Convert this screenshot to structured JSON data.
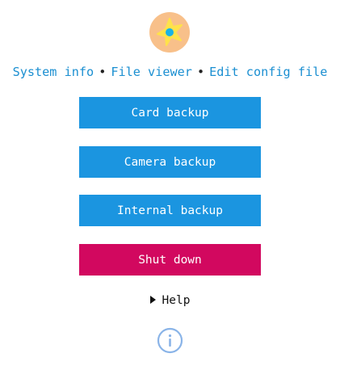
{
  "logo": {
    "icon": "starfish-logo-icon"
  },
  "nav": {
    "items": [
      "System info",
      "File viewer",
      "Edit config file"
    ],
    "separator": "•"
  },
  "buttons": {
    "card_backup": "Card backup",
    "camera_backup": "Camera backup",
    "internal_backup": "Internal backup",
    "shut_down": "Shut down"
  },
  "help": {
    "label": "Help"
  },
  "footer": {
    "icon": "info-icon"
  },
  "colors": {
    "link": "#1b8fd1",
    "button_primary": "#1b95e0",
    "button_danger": "#d2085f",
    "logo_bg": "#f8c08a",
    "logo_star": "#ffe24a",
    "logo_center": "#19b3e6",
    "info_icon": "#8ab4e8"
  }
}
